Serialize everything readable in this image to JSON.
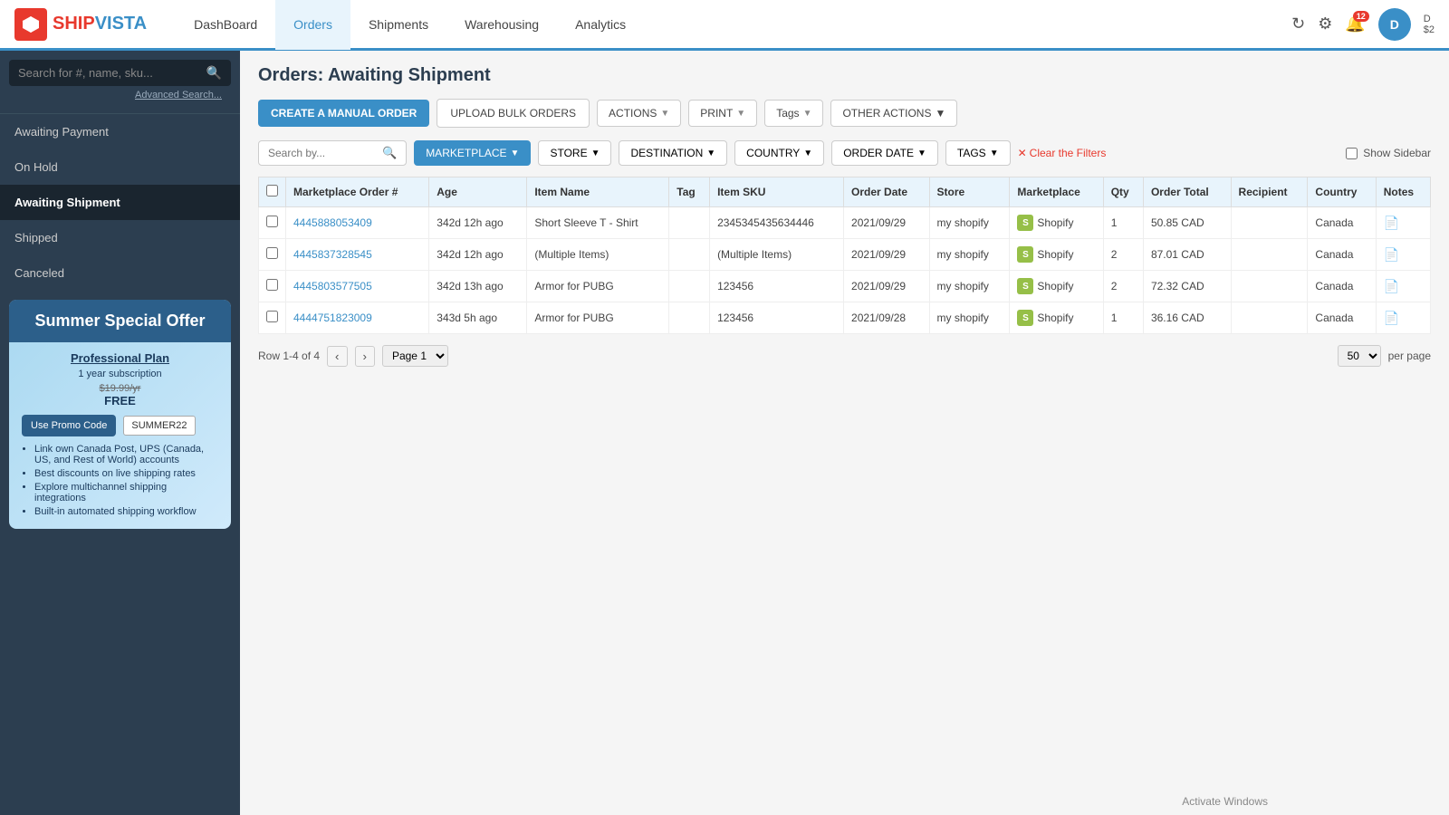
{
  "topnav": {
    "logo_ship": "SHIP",
    "logo_vista": "VISTA",
    "nav_items": [
      {
        "label": "DashBoard",
        "active": false
      },
      {
        "label": "Orders",
        "active": true
      },
      {
        "label": "Shipments",
        "active": false
      },
      {
        "label": "Warehousing",
        "active": false
      },
      {
        "label": "Analytics",
        "active": false
      }
    ],
    "notif_count": "12",
    "user_initial": "D",
    "user_balance": "$2"
  },
  "sidebar": {
    "search_placeholder": "Search for #, name, sku...",
    "advanced_search": "Advanced Search...",
    "items": [
      {
        "label": "Awaiting Payment",
        "active": false
      },
      {
        "label": "On Hold",
        "active": false
      },
      {
        "label": "Awaiting Shipment",
        "active": true
      },
      {
        "label": "Shipped",
        "active": false
      },
      {
        "label": "Canceled",
        "active": false
      }
    ],
    "promo": {
      "title": "Summer Special Offer",
      "plan": "Professional Plan",
      "subscription": "1 year subscription",
      "price_old": "$19.99/yr",
      "price_new": "FREE",
      "btn_label": "Use Promo Code",
      "promo_code": "SUMMER22",
      "features": [
        "Link own Canada Post, UPS (Canada, US, and Rest of World) accounts",
        "Best discounts on live shipping rates",
        "Explore multichannel shipping integrations",
        "Built-in automated shipping workflow"
      ]
    }
  },
  "page": {
    "title": "Orders: Awaiting Shipment"
  },
  "toolbar": {
    "create_manual": "CREATE A MANUAL ORDER",
    "upload_bulk": "UPLOAD BULK ORDERS",
    "actions": "ACTIONS",
    "print": "PRINT",
    "tags": "Tags",
    "other_actions": "OTHER ACTIONS"
  },
  "filters": {
    "search_placeholder": "Search by...",
    "marketplace": "MARKETPLACE",
    "store": "STORE",
    "destination": "DESTINATION",
    "country": "COUNTRY",
    "order_date": "ORDER DATE",
    "tags": "TAGS",
    "clear_filters": "Clear the Filters",
    "show_sidebar": "Show Sidebar"
  },
  "table": {
    "columns": [
      "Marketplace Order #",
      "Age",
      "Item Name",
      "Tag",
      "Item SKU",
      "Order Date",
      "Store",
      "Marketplace",
      "Qty",
      "Order Total",
      "Recipient",
      "Country",
      "Notes"
    ],
    "rows": [
      {
        "order_num": "4445888053409",
        "age": "342d 12h ago",
        "item_name": "Short Sleeve T - Shirt",
        "tag": "",
        "item_sku": "2345345435634446",
        "order_date": "2021/09/29",
        "store": "my shopify",
        "marketplace": "Shopify",
        "qty": "1",
        "order_total": "50.85 CAD",
        "recipient": "",
        "country": "Canada",
        "notes": "📄"
      },
      {
        "order_num": "4445837328545",
        "age": "342d 12h ago",
        "item_name": "(Multiple Items)",
        "tag": "",
        "item_sku": "(Multiple Items)",
        "order_date": "2021/09/29",
        "store": "my shopify",
        "marketplace": "Shopify",
        "qty": "2",
        "order_total": "87.01 CAD",
        "recipient": "",
        "country": "Canada",
        "notes": "📄"
      },
      {
        "order_num": "4445803577505",
        "age": "342d 13h ago",
        "item_name": "Armor for PUBG",
        "tag": "",
        "item_sku": "123456",
        "order_date": "2021/09/29",
        "store": "my shopify",
        "marketplace": "Shopify",
        "qty": "2",
        "order_total": "72.32 CAD",
        "recipient": "",
        "country": "Canada",
        "notes": "📄"
      },
      {
        "order_num": "4444751823009",
        "age": "343d 5h ago",
        "item_name": "Armor for PUBG",
        "tag": "",
        "item_sku": "123456",
        "order_date": "2021/09/28",
        "store": "my shopify",
        "marketplace": "Shopify",
        "qty": "1",
        "order_total": "36.16 CAD",
        "recipient": "",
        "country": "Canada",
        "notes": "📄"
      }
    ]
  },
  "pagination": {
    "row_info": "Row 1-4 of 4",
    "page_label": "Page 1",
    "per_page": "50",
    "per_page_label": "per page"
  },
  "activate_windows": "Activate Windows"
}
